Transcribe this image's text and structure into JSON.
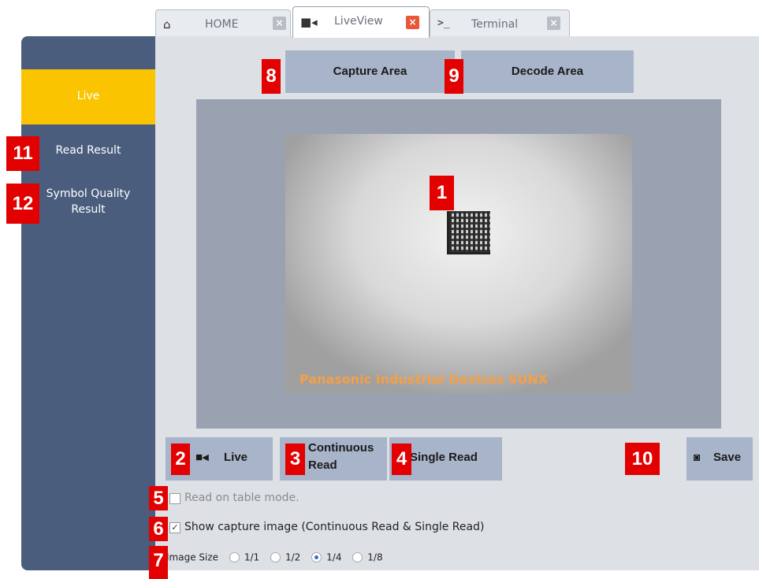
{
  "tabs": [
    {
      "icon": "home-icon",
      "label": "HOME"
    },
    {
      "icon": "video-camera-icon",
      "label": "LiveView"
    },
    {
      "icon": "terminal-icon",
      "label": "Terminal"
    }
  ],
  "sidebar": {
    "items": [
      {
        "label": "Live"
      },
      {
        "label": "Read Result"
      },
      {
        "label_line1": "Symbol Quality",
        "label_line2": "Result"
      }
    ]
  },
  "top_buttons": {
    "capture_area": "Capture Area",
    "decode_area": "Decode Area"
  },
  "camera": {
    "watermark": "Panasonic Industrial Devices SUNX"
  },
  "controls": {
    "live": "Live",
    "continuous_line1": "Continuous",
    "continuous_line2": "Read",
    "single_read": "Single Read",
    "save": "Save"
  },
  "options": {
    "table_mode": "Read on table mode.",
    "show_capture": "Show capture image (Continuous Read & Single Read)",
    "image_size_label": "Image Size",
    "image_sizes": [
      "1/1",
      "1/2",
      "1/4",
      "1/8"
    ],
    "image_size_selected": "1/4"
  },
  "badges": [
    "1",
    "2",
    "3",
    "4",
    "5",
    "6",
    "7",
    "8",
    "9",
    "10",
    "11",
    "12"
  ],
  "colors": {
    "accent": "#fbc400",
    "sidebar": "#4a5d7d",
    "button": "#a7b4c9",
    "badge": "#e30000",
    "close_active": "#e8573a"
  }
}
